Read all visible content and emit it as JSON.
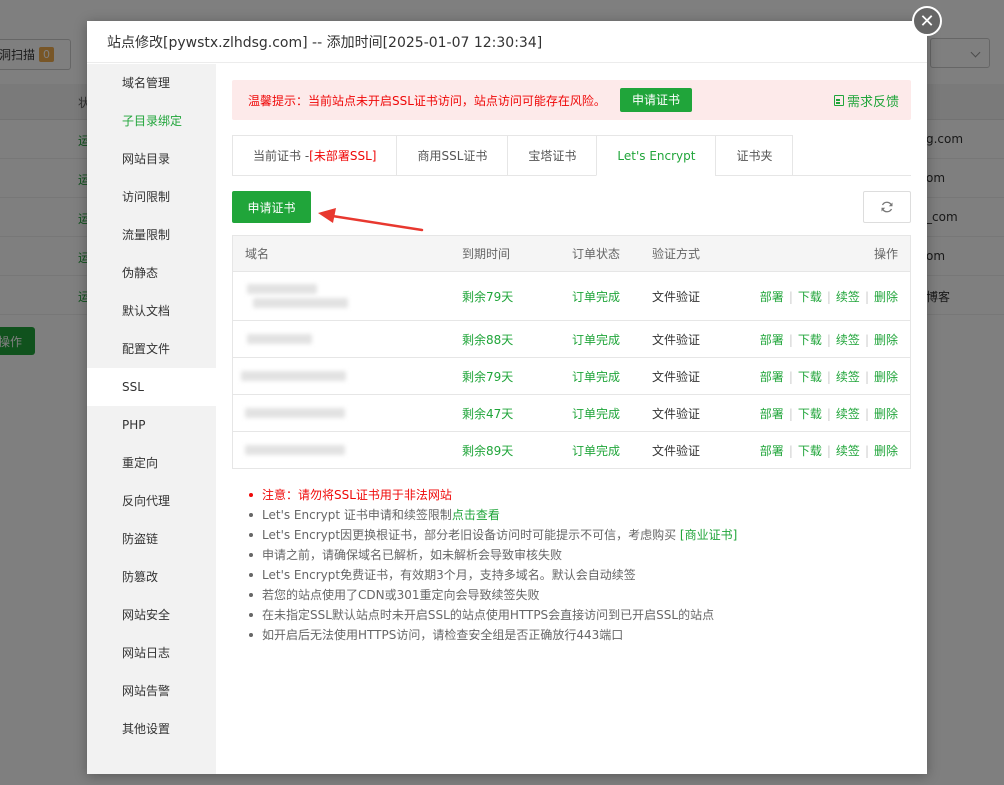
{
  "background": {
    "scan_button_label": "洞扫描",
    "scan_badge": "0",
    "status_labels": [
      "运",
      "运",
      "运",
      "运",
      "运"
    ],
    "domain_suffixes": [
      "g.com",
      "om",
      "_com",
      "om",
      "博客"
    ],
    "header_label": "状",
    "op_button_label": "操作"
  },
  "modal": {
    "title": "站点修改[pywstx.zlhdsg.com] -- 添加时间[2025-01-07 12:30:34]",
    "close_icon": "close-icon"
  },
  "sidebar": {
    "items": [
      {
        "label": "域名管理"
      },
      {
        "label": "子目录绑定"
      },
      {
        "label": "网站目录"
      },
      {
        "label": "访问限制"
      },
      {
        "label": "流量限制"
      },
      {
        "label": "伪静态"
      },
      {
        "label": "默认文档"
      },
      {
        "label": "配置文件"
      },
      {
        "label": "SSL"
      },
      {
        "label": "PHP"
      },
      {
        "label": "重定向"
      },
      {
        "label": "反向代理"
      },
      {
        "label": "防盗链"
      },
      {
        "label": "防篡改"
      },
      {
        "label": "网站安全"
      },
      {
        "label": "网站日志"
      },
      {
        "label": "网站告警"
      },
      {
        "label": "其他设置"
      }
    ]
  },
  "alert": {
    "text": "温馨提示：当前站点未开启SSL证书访问，站点访问可能存在风险。",
    "button_label": "申请证书",
    "feedback_label": "需求反馈"
  },
  "tabs": {
    "current_prefix": "当前证书 -",
    "current_status": "[未部署SSL]",
    "commercial": "商用SSL证书",
    "baota": "宝塔证书",
    "letsencrypt": "Let's Encrypt",
    "folder": "证书夹"
  },
  "toolbar": {
    "apply_label": "申请证书",
    "refresh_icon": "refresh-icon"
  },
  "table": {
    "headers": {
      "domain": "域名",
      "expire": "到期时间",
      "status": "订单状态",
      "method": "验证方式",
      "ops": "操作"
    },
    "rows": [
      {
        "domain": "",
        "expire": "剩余79天",
        "status": "订单完成",
        "method": "文件验证"
      },
      {
        "domain": "",
        "expire": "剩余88天",
        "status": "订单完成",
        "method": "文件验证"
      },
      {
        "domain": "",
        "expire": "剩余79天",
        "status": "订单完成",
        "method": "文件验证"
      },
      {
        "domain": "",
        "expire": "剩余47天",
        "status": "订单完成",
        "method": "文件验证"
      },
      {
        "domain": "",
        "expire": "剩余89天",
        "status": "订单完成",
        "method": "文件验证"
      }
    ],
    "ops": {
      "deploy": "部署",
      "download": "下载",
      "renew": "续签",
      "delete": "删除",
      "sep": "|"
    }
  },
  "notes": {
    "n1": "注意：请勿将SSL证书用于非法网站",
    "n2_prefix": "Let's Encrypt 证书申请和续签限制",
    "n2_link": "点击查看",
    "n3_prefix": "Let's Encrypt因更换根证书，部分老旧设备访问时可能提示不可信，考虑购买 ",
    "n3_link": "[商业证书]",
    "n4": "申请之前，请确保域名已解析，如未解析会导致审核失败",
    "n5": "Let's Encrypt免费证书，有效期3个月，支持多域名。默认会自动续签",
    "n6": "若您的站点使用了CDN或301重定向会导致续签失败",
    "n7": "在未指定SSL默认站点时未开启SSL的站点使用HTTPS会直接访问到已开启SSL的站点",
    "n8": "如开启后无法使用HTTPS访问，请检查安全组是否正确放行443端口"
  },
  "colors": {
    "accent": "#20a53a",
    "danger": "#ef0808",
    "alert_bg": "#fdeaea"
  }
}
